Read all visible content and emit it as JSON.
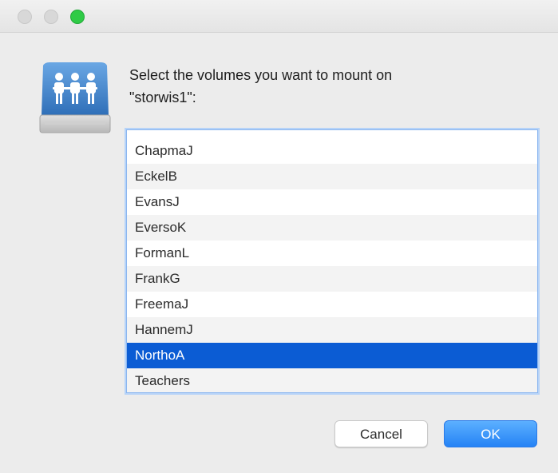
{
  "window": {
    "controls": {
      "close_color": "#d8d8d8",
      "minimize_color": "#d8d8d8",
      "zoom_color": "#2fcb46"
    }
  },
  "icon": {
    "name": "network-server-share-icon"
  },
  "prompt_line1": "Select the volumes you want to mount on",
  "prompt_line2": "\"storwis1\":",
  "volumes": [
    {
      "label": "ChapmaJ",
      "selected": false
    },
    {
      "label": "EckelB",
      "selected": false
    },
    {
      "label": "EvansJ",
      "selected": false
    },
    {
      "label": "EversoK",
      "selected": false
    },
    {
      "label": "FormanL",
      "selected": false
    },
    {
      "label": "FrankG",
      "selected": false
    },
    {
      "label": "FreemaJ",
      "selected": false
    },
    {
      "label": "HannemJ",
      "selected": false
    },
    {
      "label": "NorthoA",
      "selected": true
    },
    {
      "label": "Teachers",
      "selected": false
    }
  ],
  "buttons": {
    "cancel": "Cancel",
    "ok": "OK"
  },
  "colors": {
    "selection": "#0b5cd4",
    "accent": "#2583f5"
  }
}
